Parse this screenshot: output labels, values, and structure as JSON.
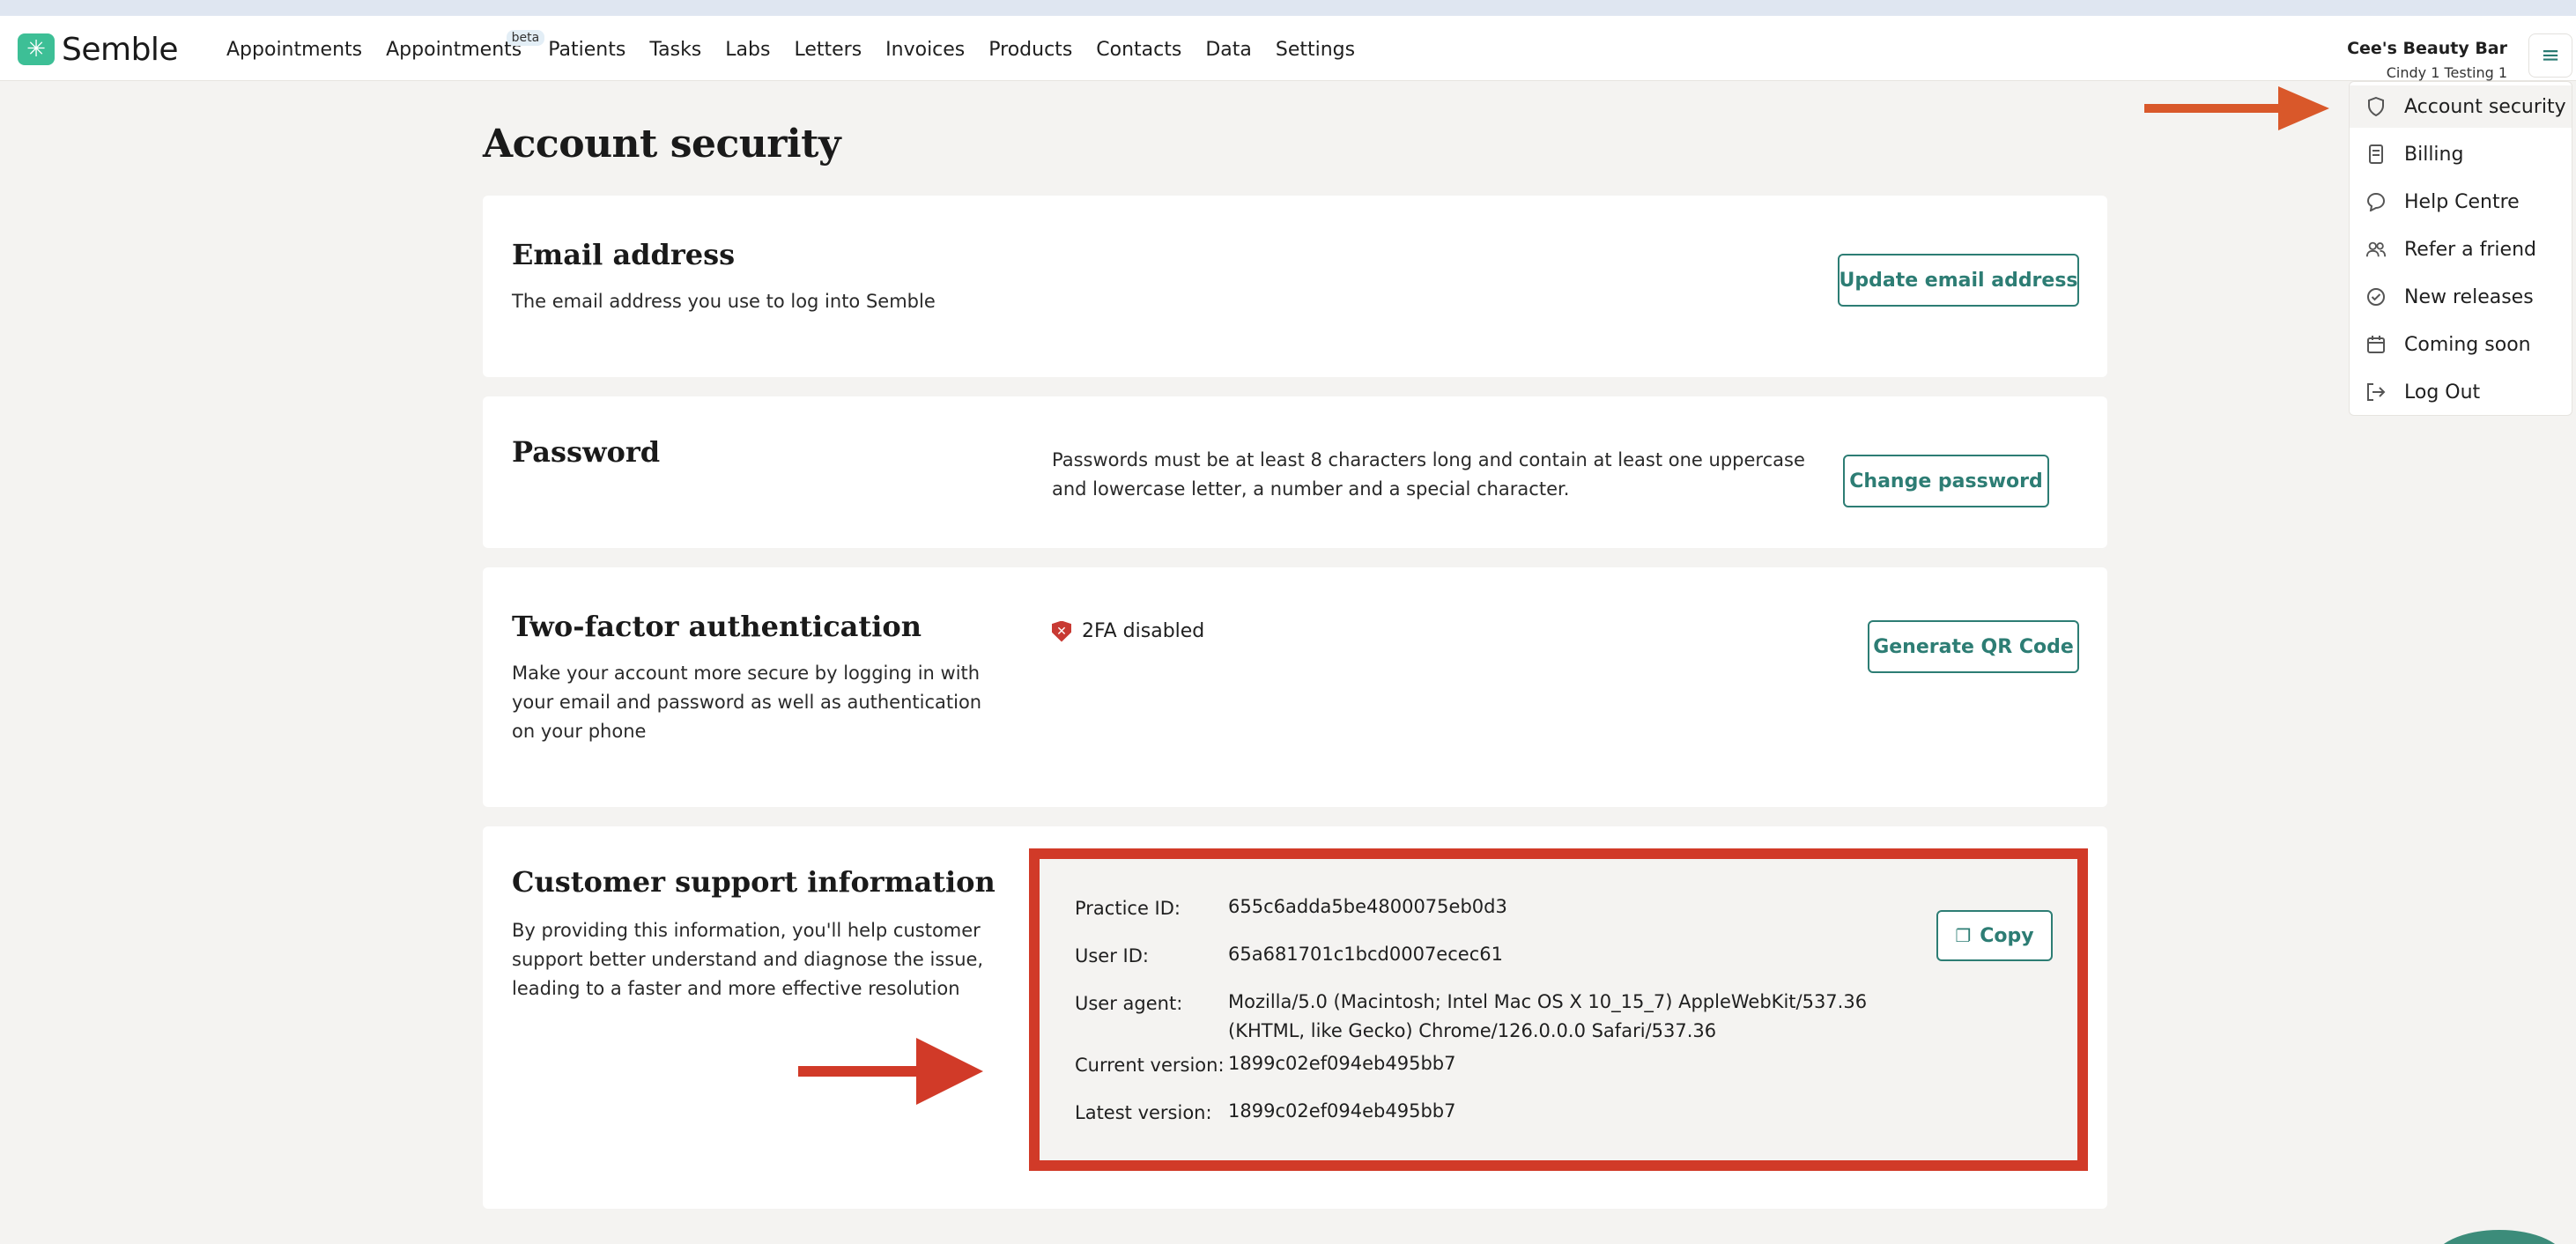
{
  "brand": {
    "name": "Semble"
  },
  "nav": {
    "items": [
      {
        "label": "Appointments"
      },
      {
        "label": "Appointments",
        "badge": "beta"
      },
      {
        "label": "Patients"
      },
      {
        "label": "Tasks"
      },
      {
        "label": "Labs"
      },
      {
        "label": "Letters"
      },
      {
        "label": "Invoices"
      },
      {
        "label": "Products"
      },
      {
        "label": "Contacts"
      },
      {
        "label": "Data"
      },
      {
        "label": "Settings"
      }
    ]
  },
  "account": {
    "name": "Cee's Beauty Bar",
    "user": "Cindy 1 Testing 1"
  },
  "page": {
    "title": "Account security"
  },
  "email_card": {
    "title": "Email address",
    "description": "The email address you use to log into Semble",
    "button": "Update email address"
  },
  "password_card": {
    "title": "Password",
    "info": "Passwords must be at least 8 characters long and contain at least one uppercase and lowercase letter, a number and a special character.",
    "button": "Change password"
  },
  "twofa_card": {
    "title": "Two-factor authentication",
    "description": "Make your account more secure by logging in with your email and password as well as authentication on your phone",
    "status": "2FA disabled",
    "button": "Generate QR Code"
  },
  "support_card": {
    "title": "Customer support information",
    "description": "By providing this information, you'll help customer support better understand and diagnose the issue, leading to a faster and more effective resolution",
    "rows": [
      {
        "label": "Practice ID:",
        "value": "655c6adda5be4800075eb0d3"
      },
      {
        "label": "User ID:",
        "value": "65a681701c1bcd0007ecec61"
      },
      {
        "label": "User agent:",
        "value": "Mozilla/5.0 (Macintosh; Intel Mac OS X 10_15_7) AppleWebKit/537.36 (KHTML, like Gecko) Chrome/126.0.0.0 Safari/537.36"
      },
      {
        "label": "Current version:",
        "value": "1899c02ef094eb495bb7"
      },
      {
        "label": "Latest version:",
        "value": "1899c02ef094eb495bb7"
      }
    ],
    "copy_button": "Copy"
  },
  "dropdown": {
    "items": [
      {
        "label": "Account security",
        "icon": "shield-icon"
      },
      {
        "label": "Billing",
        "icon": "document-icon"
      },
      {
        "label": "Help Centre",
        "icon": "chat-icon"
      },
      {
        "label": "Refer a friend",
        "icon": "users-icon"
      },
      {
        "label": "New releases",
        "icon": "check-circle-icon"
      },
      {
        "label": "Coming soon",
        "icon": "calendar-icon"
      },
      {
        "label": "Log Out",
        "icon": "logout-icon"
      }
    ]
  },
  "colors": {
    "accent": "#2d7d74",
    "annotation_red": "#d13a28",
    "menu_arrow": "#d9582a",
    "logo_green": "#3dbf96"
  }
}
